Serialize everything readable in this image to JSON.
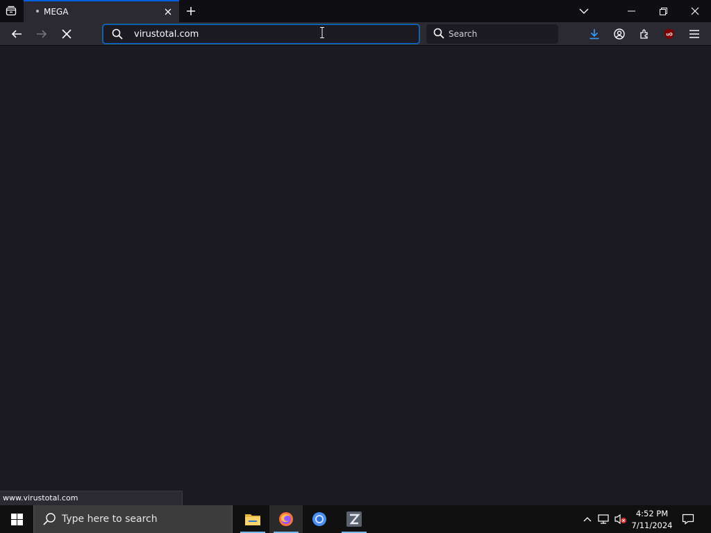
{
  "browser": {
    "tab": {
      "title": "MEGA",
      "icons": {
        "loading": "loading-dot-icon",
        "close": "close-icon"
      }
    },
    "tab_list_icon": "tab-list-icon",
    "new_tab_icon": "plus-icon",
    "list_all_tabs_icon": "chevron-down-icon",
    "window_controls": {
      "minimize": "minimize-icon",
      "restore": "restore-icon",
      "close": "close-icon"
    },
    "nav": {
      "back": "back-arrow-icon",
      "forward": "forward-arrow-icon",
      "stop": "stop-icon"
    },
    "urlbar": {
      "value": "virustotal.com",
      "icon": "search-icon"
    },
    "searchbar": {
      "placeholder": "Search",
      "icon": "search-icon"
    },
    "toolbar_icons": [
      "download-icon",
      "account-icon",
      "extensions-icon",
      "ublock-origin-icon",
      "hamburger-menu-icon"
    ],
    "status_url": "www.virustotal.com"
  },
  "taskbar": {
    "search_placeholder": "Type here to search",
    "apps": [
      "file-explorer-icon",
      "firefox-icon",
      "chrome-icon",
      "zorin-z-icon"
    ],
    "active_app": "firefox-icon",
    "tray": {
      "chevron": "chevron-up-icon",
      "network": "network-icon",
      "volume": "volume-muted-icon"
    },
    "clock": {
      "time": "4:52 PM",
      "date": "7/11/2024"
    },
    "notification_icon": "action-center-icon"
  },
  "colors": {
    "accent": "#0060df",
    "tab_bg": "#2b2a33",
    "content_bg": "#1c1b22",
    "taskbar_bg": "#101010"
  }
}
